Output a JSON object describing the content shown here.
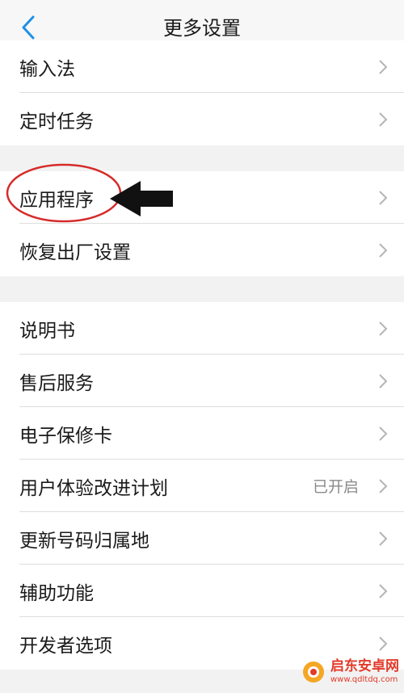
{
  "header": {
    "title": "更多设置"
  },
  "groups": [
    {
      "items": [
        {
          "label": "输入法"
        },
        {
          "label": "定时任务"
        }
      ]
    },
    {
      "items": [
        {
          "label": "应用程序"
        },
        {
          "label": "恢复出厂设置"
        }
      ]
    },
    {
      "items": [
        {
          "label": "说明书"
        },
        {
          "label": "售后服务"
        },
        {
          "label": "电子保修卡"
        },
        {
          "label": "用户体验改进计划",
          "value": "已开启"
        },
        {
          "label": "更新号码归属地"
        },
        {
          "label": "辅助功能"
        },
        {
          "label": "开发者选项"
        }
      ]
    }
  ],
  "colors": {
    "accent": "#1e90e6",
    "annotation_red": "#d62b2b",
    "annotation_arrow": "#111111"
  },
  "watermark": {
    "name": "启东安卓网",
    "url": "www.qdltdq.com"
  }
}
